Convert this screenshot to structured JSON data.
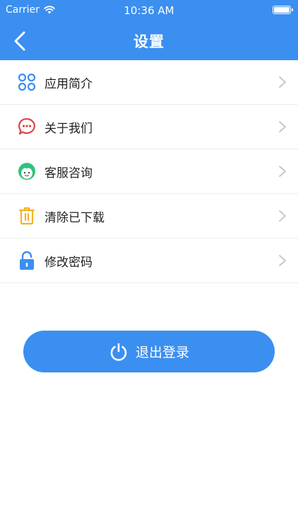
{
  "status_bar": {
    "carrier": "Carrier",
    "time": "10:36 AM"
  },
  "header": {
    "title": "设置",
    "back_icon": "chevron-left-icon"
  },
  "menu": {
    "items": [
      {
        "label": "应用简介",
        "icon": "app-grid-icon",
        "color": "#3b8ff0"
      },
      {
        "label": "关于我们",
        "icon": "chat-bubble-icon",
        "color": "#e04444"
      },
      {
        "label": "客服咨询",
        "icon": "customer-service-icon",
        "color": "#2ec27e"
      },
      {
        "label": "清除已下载",
        "icon": "trash-icon",
        "color": "#f5b323"
      },
      {
        "label": "修改密码",
        "icon": "lock-icon",
        "color": "#3b8ff0"
      }
    ]
  },
  "logout": {
    "label": "退出登录",
    "icon": "power-icon"
  },
  "colors": {
    "accent": "#3b8ff0",
    "divider": "#ececec",
    "chevron": "#c7c7cc"
  }
}
